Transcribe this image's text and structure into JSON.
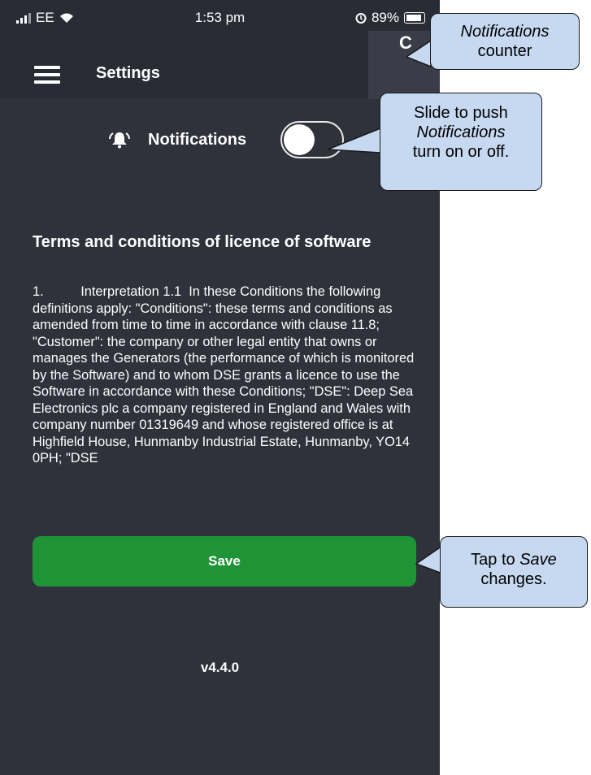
{
  "status_bar": {
    "carrier": "EE",
    "time": "1:53 pm",
    "battery": "89%"
  },
  "header": {
    "title": "Settings",
    "counter": "C"
  },
  "notifications": {
    "label": "Notifications",
    "enabled": false
  },
  "terms": {
    "title": "Terms and conditions of licence of software",
    "body": "1.          Interpretation 1.1  In these Conditions the following definitions apply: \"Conditions\": these terms and conditions as amended from time to time in accordance with clause 11.8; \"Customer\": the company or other legal entity that owns or manages the Generators (the performance of which is monitored by the Software) and to whom DSE grants a licence to use the Software in accordance with these Conditions; \"DSE\": Deep Sea Electronics plc a company registered in England and Wales with company number 01319649 and whose registered office is at Highfield House, Hunmanby Industrial Estate, Hunmanby, YO14 0PH; \"DSE"
  },
  "save_label": "Save",
  "version": "v4.4.0",
  "callouts": {
    "counter": {
      "italic": "Notifications",
      "text": "counter"
    },
    "toggle": {
      "line1": "Slide to push",
      "italic": "Notifications",
      "line3": "turn on or off."
    },
    "save": {
      "prefix": "Tap to ",
      "italic": "Save",
      "suffix": "changes."
    }
  },
  "colors": {
    "background": "#2f313b",
    "header": "#2a2c35",
    "save_button": "#1e9437",
    "callout": "#c6d9f1"
  }
}
